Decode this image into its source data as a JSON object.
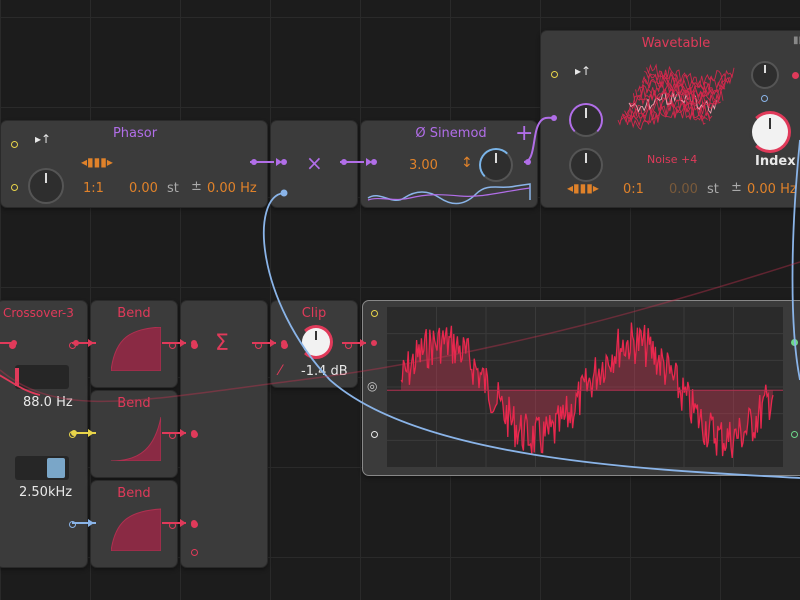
{
  "phasor": {
    "title": "Phasor",
    "ratio": "1:1",
    "offset": "0.00",
    "unit_st": "st",
    "pm": "±",
    "freq": "0.00 Hz"
  },
  "multiply": {
    "symbol": "×"
  },
  "sinemod": {
    "title": "Ø Sinemod",
    "plus": "+",
    "value": "3.00",
    "arrows": "↕"
  },
  "wavetable": {
    "title": "Wavetable",
    "preset": "Noise +4",
    "index_label": "Index",
    "ratio": "0:1",
    "offset": "0.00",
    "unit_st": "st",
    "pm": "±",
    "freq": "0.00 Hz"
  },
  "crossover": {
    "title": "Crossover-3",
    "freq_low": "88.0 Hz",
    "freq_high": "2.50kHz"
  },
  "bend1": {
    "title": "Bend"
  },
  "bend2": {
    "title": "Bend"
  },
  "bend3": {
    "title": "Bend"
  },
  "sum": {
    "symbol": "Σ"
  },
  "clip": {
    "title": "Clip",
    "value": "-1.4 dB"
  },
  "colors": {
    "purple": "#b16ee8",
    "red": "#e03a5a",
    "orange": "#e0822a",
    "blue": "#8ab4e8",
    "yellow": "#e8d44a",
    "green": "#6ed88a"
  }
}
